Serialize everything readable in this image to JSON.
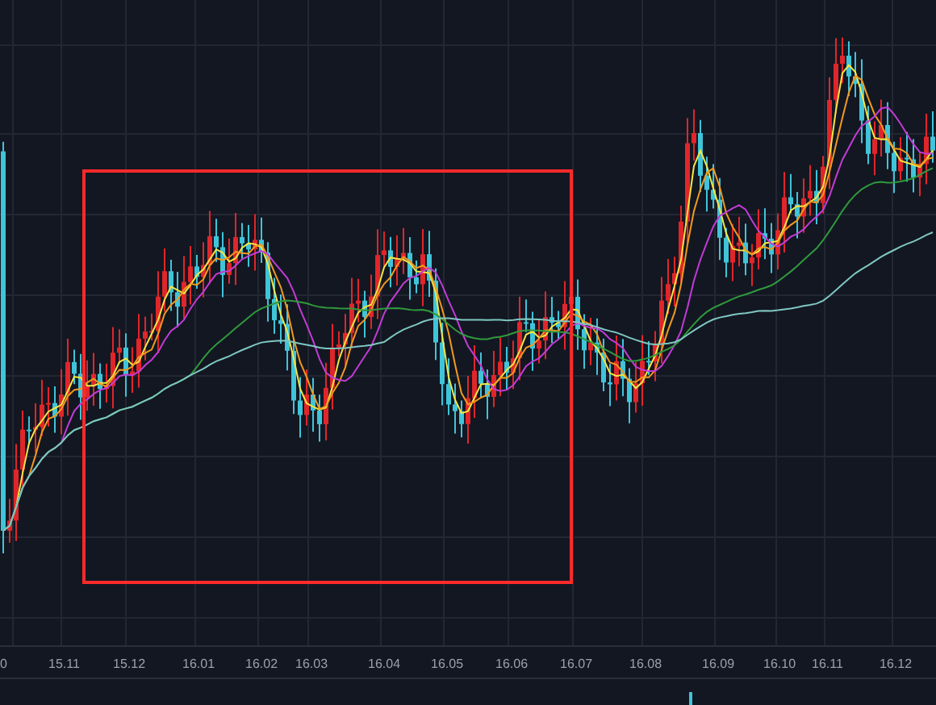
{
  "x_axis": {
    "labels": [
      "0",
      "15.11",
      "15.12",
      "16.01",
      "16.02",
      "16.03",
      "16.04",
      "16.05",
      "16.06",
      "16.07",
      "16.08",
      "16.09",
      "16.10",
      "16.11",
      "16.12"
    ]
  }
}
